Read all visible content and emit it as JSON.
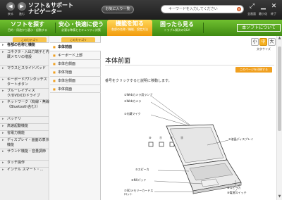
{
  "toolbar": {
    "back_label": "戻る",
    "forward_label": "進む",
    "app_title_line1": "ソフト＆サポート",
    "app_title_line2": "ナビゲーター",
    "favorites_label": "お気に入り一覧",
    "search_placeholder": "キーワードを入力してください",
    "zoom_label": "全画面",
    "minimize_label": "最小化",
    "close_label": "終了"
  },
  "menu": {
    "items": [
      {
        "title": "ソフトを探す",
        "sub": "目的・用途から選ぶ・起動する"
      },
      {
        "title": "安心・快適に使う",
        "sub": "必要な準備とセキュリティ対策"
      },
      {
        "title": "機能を知る",
        "sub": "各部の名称／機能、設定方法"
      },
      {
        "title": "困ったら見る",
        "sub": "トラブル解決のQ&A"
      }
    ],
    "about_label": "本ソフトについて"
  },
  "left_nav": {
    "tab_label": "このカテゴリ",
    "items": [
      "各部の名称と機能",
      "コネクタ・入出力端子と内蔵メモリの増設",
      "マウスとスライドパッド",
      "キーボード/ワンタッチスタートボタン",
      "ブルーレイディスク/DVD/CDドライブ",
      "ネットワーク（有線・無線（Bluetooth含む））",
      "バッテリ",
      "高速起動機能",
      "省電力機能",
      "ディスプレイ・画面の表示機能",
      "サウンド機能・音量調節",
      "タッチ操作",
      "インテル スマート・…"
    ]
  },
  "mid_nav": {
    "tab_label": "このカテゴリ",
    "items": [
      "本体前面",
      "キーボード上部",
      "本体右側面",
      "本体背面",
      "本体左側面",
      "本体底面"
    ]
  },
  "content": {
    "font_size_caption": "文字サイズ",
    "font_sizes": [
      "小",
      "中",
      "大"
    ],
    "title": "本体前面",
    "print_label": "このページを印刷する",
    "intro": "番号をクリックすると説明に移動します。",
    "callouts": [
      "①Webカメラ用ランプ",
      "②Webカメラ",
      "③内蔵マイク",
      "④液晶ディスプレイ",
      "⑤スピーカ",
      "⑥NXパッド",
      "⑦SDメモリーカードスロット",
      "⑧スピーカ",
      "⑨電源スイッチ"
    ],
    "indicator_numbers": [
      "⑩",
      "⑪",
      "⑫",
      "⑬"
    ]
  },
  "colors": {
    "menubar_green": "#4c9a18",
    "active_tab_orange": "#f5a81a",
    "topbar_dark": "#2a2a2a"
  }
}
